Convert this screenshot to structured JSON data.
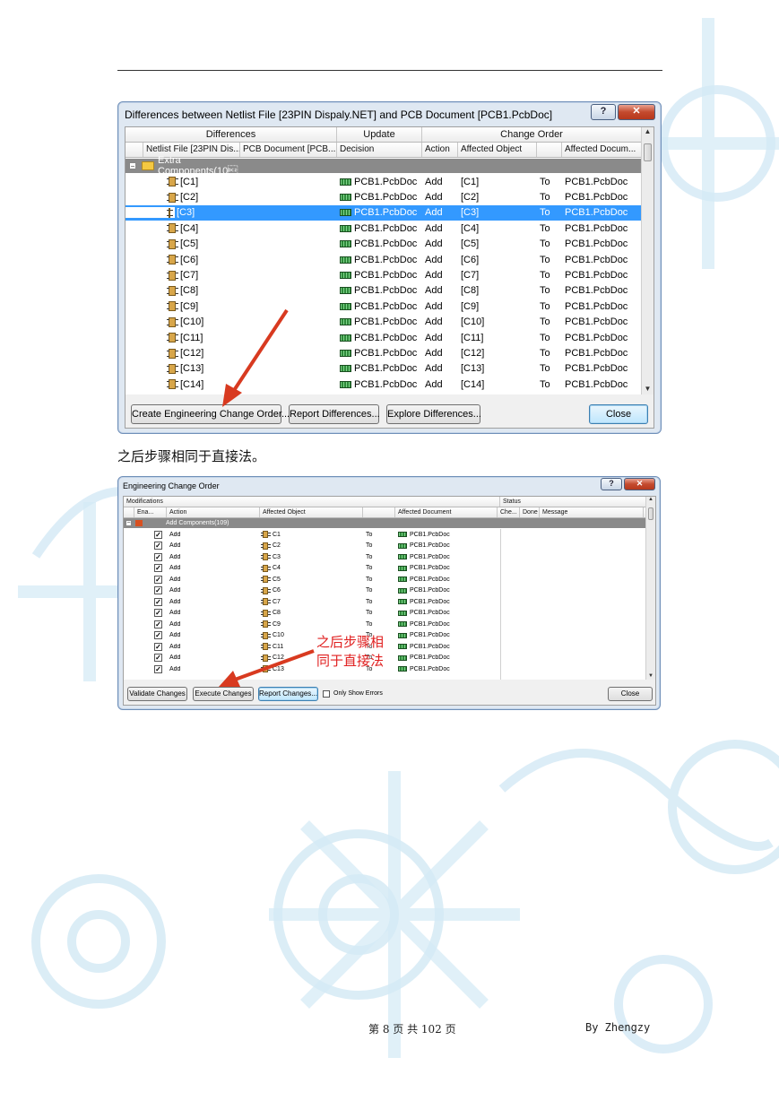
{
  "dialog1": {
    "title": "Differences between Netlist File [23PIN Dispaly.NET] and PCB Document [PCB1.PcbDoc]",
    "help_label": "?",
    "close_x": "✕",
    "header1": [
      "Differences",
      "Update",
      "Change Order"
    ],
    "header2": [
      "Netlist File [23PIN Dis...",
      "PCB Document [PCB...",
      "Decision",
      "Action",
      "Affected Object",
      "",
      "Affected Docum..."
    ],
    "group_label": "Extra Components(10\u0012",
    "rows": [
      {
        "comp": "[C1]",
        "decision": "PCB1.PcbDoc",
        "action": "Add",
        "object": "[C1]",
        "to": "To",
        "doc": "PCB1.PcbDoc"
      },
      {
        "comp": "[C2]",
        "decision": "PCB1.PcbDoc",
        "action": "Add",
        "object": "[C2]",
        "to": "To",
        "doc": "PCB1.PcbDoc"
      },
      {
        "comp": "[C3]",
        "decision": "PCB1.PcbDoc",
        "action": "Add",
        "object": "[C3]",
        "to": "To",
        "doc": "PCB1.PcbDoc"
      },
      {
        "comp": "[C4]",
        "decision": "PCB1.PcbDoc",
        "action": "Add",
        "object": "[C4]",
        "to": "To",
        "doc": "PCB1.PcbDoc"
      },
      {
        "comp": "[C5]",
        "decision": "PCB1.PcbDoc",
        "action": "Add",
        "object": "[C5]",
        "to": "To",
        "doc": "PCB1.PcbDoc"
      },
      {
        "comp": "[C6]",
        "decision": "PCB1.PcbDoc",
        "action": "Add",
        "object": "[C6]",
        "to": "To",
        "doc": "PCB1.PcbDoc"
      },
      {
        "comp": "[C7]",
        "decision": "PCB1.PcbDoc",
        "action": "Add",
        "object": "[C7]",
        "to": "To",
        "doc": "PCB1.PcbDoc"
      },
      {
        "comp": "[C8]",
        "decision": "PCB1.PcbDoc",
        "action": "Add",
        "object": "[C8]",
        "to": "To",
        "doc": "PCB1.PcbDoc"
      },
      {
        "comp": "[C9]",
        "decision": "PCB1.PcbDoc",
        "action": "Add",
        "object": "[C9]",
        "to": "To",
        "doc": "PCB1.PcbDoc"
      },
      {
        "comp": "[C10]",
        "decision": "PCB1.PcbDoc",
        "action": "Add",
        "object": "[C10]",
        "to": "To",
        "doc": "PCB1.PcbDoc"
      },
      {
        "comp": "[C11]",
        "decision": "PCB1.PcbDoc",
        "action": "Add",
        "object": "[C11]",
        "to": "To",
        "doc": "PCB1.PcbDoc"
      },
      {
        "comp": "[C12]",
        "decision": "PCB1.PcbDoc",
        "action": "Add",
        "object": "[C12]",
        "to": "To",
        "doc": "PCB1.PcbDoc"
      },
      {
        "comp": "[C13]",
        "decision": "PCB1.PcbDoc",
        "action": "Add",
        "object": "[C13]",
        "to": "To",
        "doc": "PCB1.PcbDoc"
      },
      {
        "comp": "[C14]",
        "decision": "PCB1.PcbDoc",
        "action": "Add",
        "object": "[C14]",
        "to": "To",
        "doc": "PCB1.PcbDoc"
      }
    ],
    "selected_row": 2,
    "buttons": {
      "create_eco": "Create Engineering Change Order...",
      "report": "Report Differences...",
      "explore": "Explore Differences...",
      "close": "Close"
    }
  },
  "caption": "之后步骤相同于直接法。",
  "dialog2": {
    "title": "Engineering Change Order",
    "help_label": "?",
    "close_x": "✕",
    "header1": [
      "Modifications",
      "Status"
    ],
    "header2": [
      "Ena...",
      "Action",
      "Affected Object",
      "",
      "Affected Document",
      "Che...",
      "Done",
      "Message"
    ],
    "group_label": "Add Components(109)",
    "rows": [
      {
        "action": "Add",
        "object": "C1",
        "to": "To",
        "doc": "PCB1.PcbDoc"
      },
      {
        "action": "Add",
        "object": "C2",
        "to": "To",
        "doc": "PCB1.PcbDoc"
      },
      {
        "action": "Add",
        "object": "C3",
        "to": "To",
        "doc": "PCB1.PcbDoc"
      },
      {
        "action": "Add",
        "object": "C4",
        "to": "To",
        "doc": "PCB1.PcbDoc"
      },
      {
        "action": "Add",
        "object": "C5",
        "to": "To",
        "doc": "PCB1.PcbDoc"
      },
      {
        "action": "Add",
        "object": "C6",
        "to": "To",
        "doc": "PCB1.PcbDoc"
      },
      {
        "action": "Add",
        "object": "C7",
        "to": "To",
        "doc": "PCB1.PcbDoc"
      },
      {
        "action": "Add",
        "object": "C8",
        "to": "To",
        "doc": "PCB1.PcbDoc"
      },
      {
        "action": "Add",
        "object": "C9",
        "to": "To",
        "doc": "PCB1.PcbDoc"
      },
      {
        "action": "Add",
        "object": "C10",
        "to": "To",
        "doc": "PCB1.PcbDoc"
      },
      {
        "action": "Add",
        "object": "C11",
        "to": "To",
        "doc": "PCB1.PcbDoc"
      },
      {
        "action": "Add",
        "object": "C12",
        "to": "To",
        "doc": "PCB1.PcbDoc"
      },
      {
        "action": "Add",
        "object": "C13",
        "to": "To",
        "doc": "PCB1.PcbDoc"
      }
    ],
    "check_mark": "✓",
    "buttons": {
      "validate": "Validate Changes",
      "execute": "Execute Changes",
      "report": "Report Changes...",
      "only_errors": "Only Show Errors",
      "close": "Close"
    },
    "annotation": [
      "之后步骤相",
      "同于直接法"
    ]
  },
  "footer": {
    "page_info": "第 8 页 共 102 页",
    "author": "By Zhengzy"
  },
  "colors": {
    "arrow": "#d83a20",
    "selection": "#3399ff",
    "group_bar": "#8a8a8a",
    "background_pattern": "#d8ecf6"
  }
}
